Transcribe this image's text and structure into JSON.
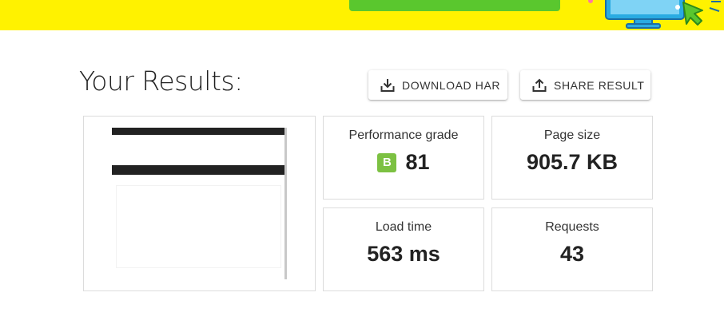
{
  "banner": {
    "background_color": "#fff200",
    "cta_color": "#5ac72e",
    "illustration_icon": "computer-monitor-cursor-icon"
  },
  "header": {
    "title": "Your Results:"
  },
  "actions": {
    "download_label": "DOWNLOAD HAR",
    "download_icon": "download-icon",
    "share_label": "SHARE RESULT",
    "share_icon": "share-icon"
  },
  "stats": {
    "performance": {
      "label": "Performance grade",
      "grade": "B",
      "grade_color": "#7cc142",
      "score": "81"
    },
    "page_size": {
      "label": "Page size",
      "value": "905.7 KB"
    },
    "load_time": {
      "label": "Load time",
      "value": "563 ms"
    },
    "requests": {
      "label": "Requests",
      "value": "43"
    }
  }
}
